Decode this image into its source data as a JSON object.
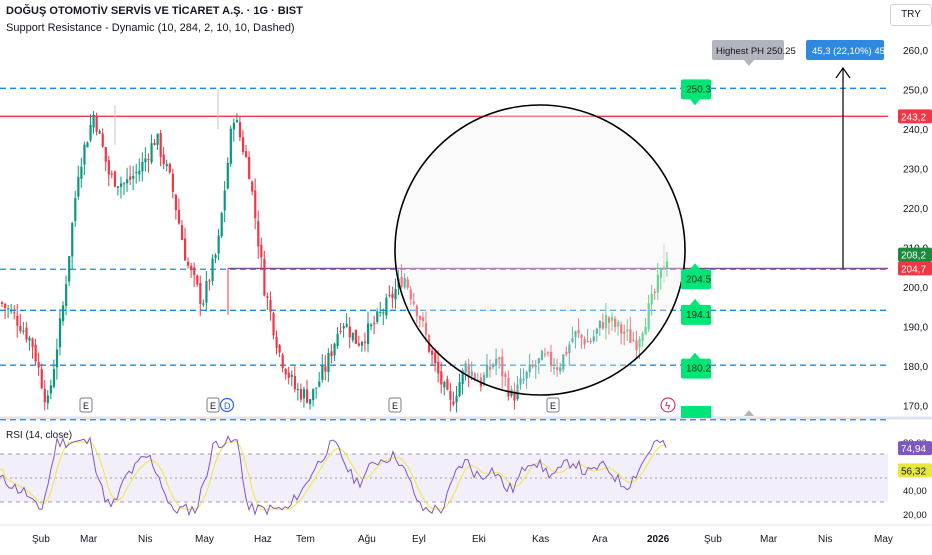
{
  "header": {
    "title": "DOĞUŞ OTOMOTİV SERVİS VE TİCARET A.Ş. · 1G · BIST",
    "indicator": "Support Resistance - Dynamic (10, 284, 2, 10, 10, Dashed)",
    "currency": "TRY"
  },
  "colors": {
    "up": "#089981",
    "up_bright": "#22cc22",
    "down": "#f23645",
    "dashed_level": "#2962ff",
    "resistance": "#f23645",
    "label_green": "#00e676",
    "rsi_line": "#7e57c2",
    "rsi_ma": "#f2e85a",
    "rsi_band": "#ede7f6",
    "callout_blue": "#2f89e0"
  },
  "chart_data": [
    {
      "type": "candlestick",
      "symbol": "DOĞUŞ OTOMOTİV SERVİS VE TİCARET A.Ş.",
      "interval": "1G",
      "exchange": "BIST",
      "currency": "TRY",
      "ylim": [
        163,
        260
      ],
      "y_ticks": [
        170,
        180,
        190,
        200,
        210,
        220,
        230,
        240,
        250,
        260
      ],
      "y_tick_labels": [
        "170,0",
        "180,0",
        "190,0",
        "200,0",
        "210,0",
        "220,0",
        "230,0",
        "240,0",
        "250,0",
        "260,0"
      ],
      "x_ticks": [
        "Şub",
        "Mar",
        "Nis",
        "May",
        "Haz",
        "Tem",
        "Ağu",
        "Eyl",
        "Eki",
        "Kas",
        "Ara",
        "2026",
        "Şub",
        "Mar",
        "Nis",
        "May"
      ],
      "close_path": [
        [
          "Şub",
          196
        ],
        [
          "Şub",
          192
        ],
        [
          "Şub",
          186
        ],
        [
          "Mar",
          170
        ],
        [
          "Mar",
          195
        ],
        [
          "Mar",
          230
        ],
        [
          "Mar",
          244
        ],
        [
          "Mar",
          228
        ],
        [
          "Nis",
          226
        ],
        [
          "Nis",
          230
        ],
        [
          "Nis",
          238
        ],
        [
          "Nis",
          226
        ],
        [
          "Nis",
          206
        ],
        [
          "May",
          196
        ],
        [
          "May",
          210
        ],
        [
          "May",
          244
        ],
        [
          "May",
          230
        ],
        [
          "Haz",
          200
        ],
        [
          "Haz",
          183
        ],
        [
          "Haz",
          174
        ],
        [
          "Tem",
          172
        ],
        [
          "Tem",
          180
        ],
        [
          "Tem",
          192
        ],
        [
          "Tem",
          186
        ],
        [
          "Ağu",
          190
        ],
        [
          "Ağu",
          196
        ],
        [
          "Ağu",
          203
        ],
        [
          "Eyl",
          193
        ],
        [
          "Eyl",
          180
        ],
        [
          "Eyl",
          170
        ],
        [
          "Eki",
          180
        ],
        [
          "Eki",
          176
        ],
        [
          "Eki",
          182
        ],
        [
          "Eki",
          172
        ],
        [
          "Kas",
          178
        ],
        [
          "Kas",
          182
        ],
        [
          "Kas",
          180
        ],
        [
          "Ara",
          188
        ],
        [
          "Ara",
          186
        ],
        [
          "Ara",
          192
        ],
        [
          "Ara",
          189
        ],
        [
          "Ara",
          186
        ],
        [
          "2026",
          196
        ],
        [
          "2026",
          208
        ]
      ],
      "last_price": 208.2,
      "levels": {
        "dashed_support_resistance": [
          250.3,
          204.5,
          194.1,
          180.2,
          166.4
        ],
        "resistance_line": 243.2,
        "horizontal_ray": 204.7
      },
      "price_labels": [
        "250.3",
        "204.5",
        "194.1",
        "180.2"
      ],
      "highest_ph_label": "Highest PH 250.25",
      "axis_badges": [
        {
          "text": "243,2",
          "color": "#f23645"
        },
        {
          "text": "208,2",
          "color": "#1b8a3c"
        },
        {
          "text": "204,7",
          "color": "#f23645"
        }
      ],
      "measure_callout": "45,3 (22,10%) 453",
      "event_markers": [
        "E",
        "E",
        "D",
        "E",
        "E"
      ]
    },
    {
      "type": "line",
      "title": "RSI (14, close)",
      "ylim": [
        14,
        84
      ],
      "y_ticks": [
        20,
        40,
        60,
        80
      ],
      "y_tick_labels": [
        "20,00",
        "40,00",
        "60,00",
        "80,00"
      ],
      "bands": [
        30,
        70
      ],
      "series": [
        {
          "name": "RSI",
          "color": "#7e57c2",
          "last": "74,94"
        },
        {
          "name": "RSI MA",
          "color": "#f2e85a",
          "last": "56,32"
        }
      ]
    }
  ]
}
